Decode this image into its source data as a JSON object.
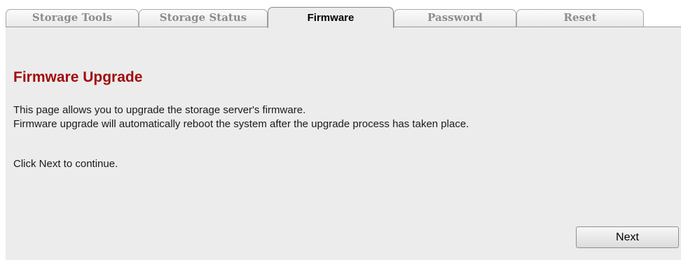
{
  "tabs": [
    {
      "label": "Storage Tools",
      "active": false
    },
    {
      "label": "Storage Status",
      "active": false
    },
    {
      "label": "Firmware",
      "active": true
    },
    {
      "label": "Password",
      "active": false
    },
    {
      "label": "Reset",
      "active": false
    }
  ],
  "main": {
    "heading": "Firmware Upgrade",
    "description_line1": "This page allows you to upgrade the storage server's firmware.",
    "description_line2": "Firmware upgrade will automatically reboot the system after the upgrade process has taken place.",
    "instruction": "Click Next to continue.",
    "next_label": "Next"
  },
  "colors": {
    "heading": "#a10c0c",
    "panel_background": "#ececec",
    "inactive_tab_text": "#8c8c8c",
    "active_tab_text": "#000000"
  }
}
